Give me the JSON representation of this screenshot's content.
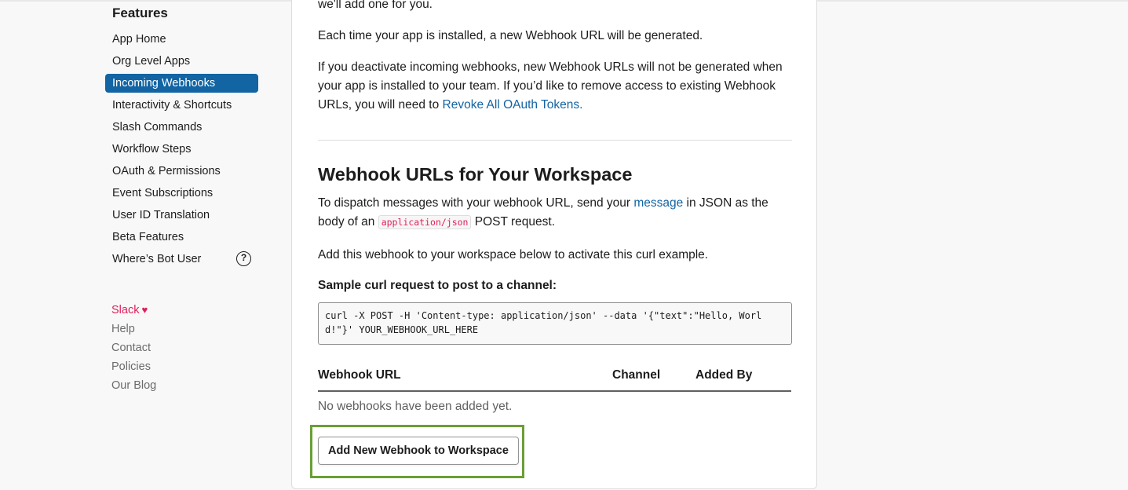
{
  "sidebar": {
    "heading": "Features",
    "items": [
      {
        "label": "App Home"
      },
      {
        "label": "Org Level Apps"
      },
      {
        "label": "Incoming Webhooks",
        "active": true
      },
      {
        "label": "Interactivity & Shortcuts"
      },
      {
        "label": "Slash Commands"
      },
      {
        "label": "Workflow Steps"
      },
      {
        "label": "OAuth & Permissions"
      },
      {
        "label": "Event Subscriptions"
      },
      {
        "label": "User ID Translation"
      },
      {
        "label": "Beta Features"
      },
      {
        "label": "Where’s Bot User",
        "help_icon": "?"
      }
    ],
    "footer": {
      "slack": "Slack",
      "heart": "♥",
      "links": [
        "Help",
        "Contact",
        "Policies",
        "Our Blog"
      ]
    }
  },
  "main": {
    "intro_tail": "we'll add one for you.",
    "p_generated": "Each time your app is installed, a new Webhook URL will be generated.",
    "p_deactivate": "If you deactivate incoming webhooks, new Webhook URLs will not be generated when your app is installed to your team. If you’d like to remove access to existing Webhook URLs, you will need to ",
    "revoke_link": "Revoke All OAuth Tokens.",
    "section_title": "Webhook URLs for Your Workspace",
    "dispatch_a": "To dispatch messages with your webhook URL, send your ",
    "dispatch_link": "message",
    "dispatch_b": " in JSON as the body of an ",
    "dispatch_code": "application/json",
    "dispatch_c": " POST request.",
    "add_hint": "Add this webhook to your workspace below to activate this curl example.",
    "sample_label": "Sample curl request to post to a channel:",
    "curl": "curl -X POST -H 'Content-type: application/json' --data '{\"text\":\"Hello, World!\"}' YOUR_WEBHOOK_URL_HERE",
    "table": {
      "headers": [
        "Webhook URL",
        "Channel",
        "Added By"
      ],
      "empty": "No webhooks have been added yet."
    },
    "add_button": "Add New Webhook to Workspace"
  },
  "colors": {
    "accent": "#1264a3",
    "slack_pink": "#e01e5a",
    "highlight_green": "#6a9f35"
  }
}
